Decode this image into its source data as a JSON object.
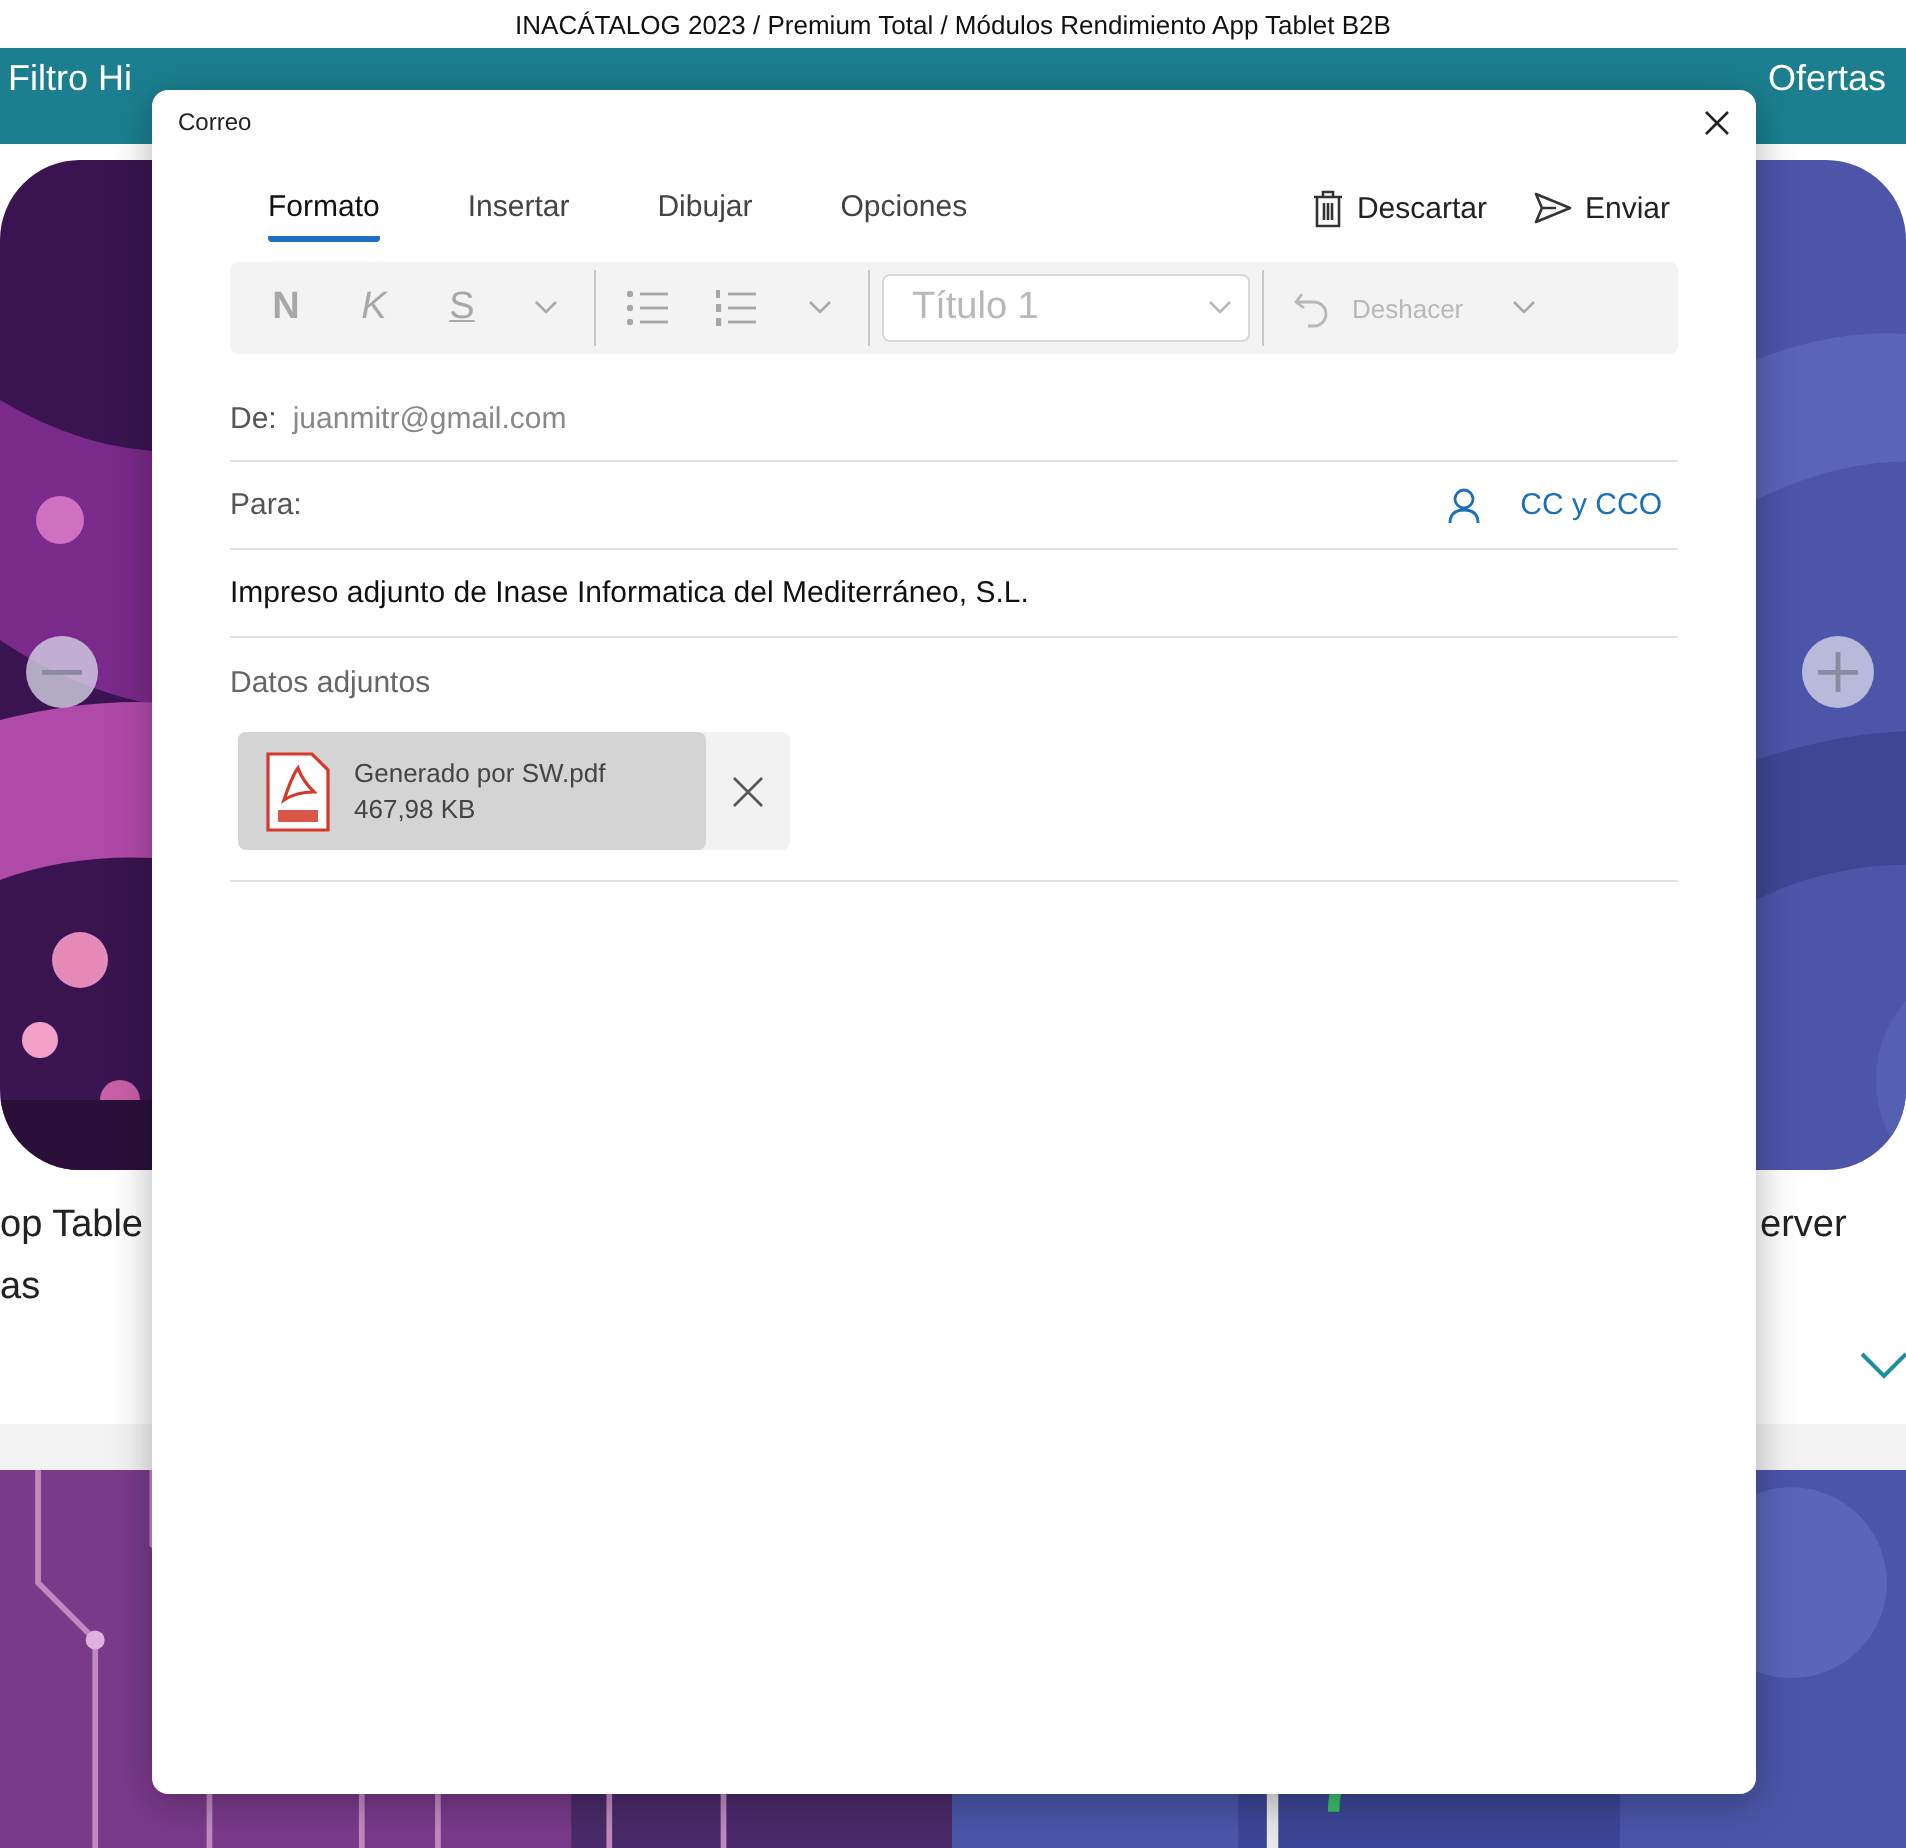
{
  "window": {
    "title": "INACÁTALOG 2023 / Premium Total / Módulos Rendimiento App Tablet B2B"
  },
  "app_header": {
    "left_filter": "Filtro Hi",
    "right_filter": "Ofertas"
  },
  "background_cards": [
    {
      "lines": [
        "op Table",
        "as"
      ]
    },
    {
      "lines": [
        "erver"
      ]
    }
  ],
  "dialog": {
    "title": "Correo",
    "tabs": [
      {
        "label": "Formato",
        "selected": true
      },
      {
        "label": "Insertar",
        "selected": false
      },
      {
        "label": "Dibujar",
        "selected": false
      },
      {
        "label": "Opciones",
        "selected": false
      }
    ],
    "actions": [
      {
        "kind": "discard",
        "label": "Descartar"
      },
      {
        "kind": "send",
        "label": "Enviar"
      }
    ],
    "toolbar": [
      {
        "kind": "bold",
        "label": "N",
        "disabled": true
      },
      {
        "kind": "italic",
        "label": "K",
        "disabled": true
      },
      {
        "kind": "underline",
        "label": "S",
        "disabled": true
      },
      {
        "kind": "more",
        "disabled": true
      },
      {
        "kind": "separator"
      },
      {
        "kind": "bullets",
        "disabled": true
      },
      {
        "kind": "numbering",
        "disabled": true
      },
      {
        "kind": "more",
        "disabled": true
      },
      {
        "kind": "separator"
      },
      {
        "kind": "style",
        "value": "Título 1",
        "disabled": true
      },
      {
        "kind": "separator"
      },
      {
        "kind": "undo",
        "label": "Deshacer",
        "disabled": true
      },
      {
        "kind": "more",
        "disabled": true
      }
    ],
    "from": {
      "label": "De:",
      "value": "juanmitr@gmail.com"
    },
    "to": {
      "label": "Para:",
      "cc_link": "CC y CCO"
    },
    "subject": {
      "value": "Impreso adjunto de Inase Informatica del Mediterráneo, S.L."
    },
    "attachments": {
      "label": "Datos adjuntos",
      "files": [
        {
          "name": "Generado por SW.pdf",
          "size": "467,98 KB"
        }
      ]
    }
  }
}
